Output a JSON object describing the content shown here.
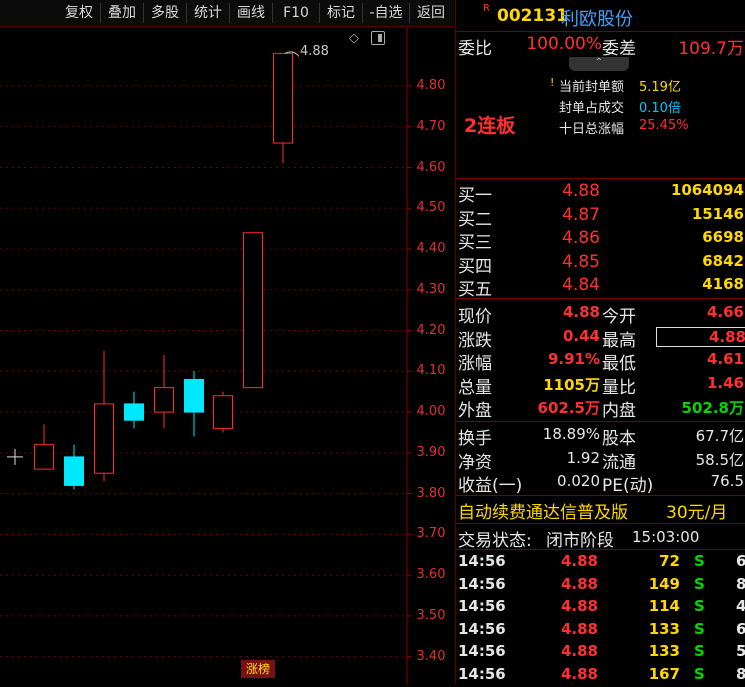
{
  "toolbar": {
    "buttons": [
      "复权",
      "叠加",
      "多股",
      "统计",
      "画线",
      "F10",
      "标记",
      "-自选",
      "返回"
    ]
  },
  "chart": {
    "price_labels": [
      "4.80",
      "4.70",
      "4.60",
      "4.50",
      "4.40",
      "4.30",
      "4.20",
      "4.10",
      "4.00",
      "3.90",
      "3.80",
      "3.70",
      "3.60",
      "3.50",
      "3.40"
    ],
    "last_price_tag": "4.88",
    "badge": "涨榜",
    "colors": {
      "up": "#ff2a2a",
      "down": "#00e8ff",
      "grid": "#6a0000",
      "axis": "#8a0000"
    }
  },
  "chart_data": {
    "type": "candlestick",
    "ylim": [
      3.35,
      4.93
    ],
    "candles": [
      {
        "open": 3.86,
        "close": 3.92,
        "high": 3.97,
        "low": 3.86,
        "dir": "up"
      },
      {
        "open": 3.89,
        "close": 3.82,
        "high": 3.92,
        "low": 3.81,
        "dir": "down"
      },
      {
        "open": 3.85,
        "close": 4.02,
        "high": 4.15,
        "low": 3.83,
        "dir": "up"
      },
      {
        "open": 4.02,
        "close": 3.98,
        "high": 4.05,
        "low": 3.96,
        "dir": "down"
      },
      {
        "open": 4.0,
        "close": 4.06,
        "high": 4.14,
        "low": 3.96,
        "dir": "up"
      },
      {
        "open": 4.08,
        "close": 4.0,
        "high": 4.1,
        "low": 3.94,
        "dir": "down"
      },
      {
        "open": 3.96,
        "close": 4.04,
        "high": 4.05,
        "low": 3.95,
        "dir": "up"
      },
      {
        "open": 4.06,
        "close": 4.44,
        "high": 4.44,
        "low": 4.06,
        "dir": "up"
      },
      {
        "open": 4.66,
        "close": 4.88,
        "high": 4.88,
        "low": 4.61,
        "dir": "up"
      }
    ]
  },
  "panel": {
    "stock_flag": "R",
    "code": "002131",
    "name": "利欧股份",
    "weibi_label": "委比",
    "weibi_value": "100.00%",
    "weicha_label": "委差",
    "weicha_value": "109.7万",
    "board_text": "2连板",
    "seal_rows": [
      {
        "label": "当前封单额",
        "value": "5.19亿",
        "color": "yellow"
      },
      {
        "label": "封单占成交",
        "value": "0.10倍",
        "color": "cyan"
      },
      {
        "label": "十日总涨幅",
        "value": "25.45%",
        "color": "red"
      }
    ],
    "bids": [
      {
        "label": "买一",
        "price": "4.88",
        "vol": "1064094"
      },
      {
        "label": "买二",
        "price": "4.87",
        "vol": "15146"
      },
      {
        "label": "买三",
        "price": "4.86",
        "vol": "6698"
      },
      {
        "label": "买四",
        "price": "4.85",
        "vol": "6842"
      },
      {
        "label": "买五",
        "price": "4.84",
        "vol": "4168"
      }
    ],
    "quote": [
      {
        "l1": "现价",
        "v1": "4.88",
        "c1": "red",
        "l2": "今开",
        "v2": "4.66",
        "c2": "red"
      },
      {
        "l1": "涨跌",
        "v1": "0.44",
        "c1": "red",
        "l2": "最高",
        "v2": "4.88",
        "c2": "red"
      },
      {
        "l1": "涨幅",
        "v1": "9.91%",
        "c1": "red",
        "l2": "最低",
        "v2": "4.61",
        "c2": "red"
      },
      {
        "l1": "总量",
        "v1": "1105万",
        "c1": "yellow",
        "l2": "量比",
        "v2": "1.46",
        "c2": "red"
      },
      {
        "l1": "外盘",
        "v1": "602.5万",
        "c1": "red",
        "l2": "内盘",
        "v2": "502.8万",
        "c2": "green"
      }
    ],
    "stats": [
      {
        "l1": "换手",
        "v1": "18.89%",
        "l2": "股本",
        "v2": "67.7亿"
      },
      {
        "l1": "净资",
        "v1": "1.92",
        "l2": "流通",
        "v2": "58.5亿"
      },
      {
        "l1": "收益(一)",
        "v1": "0.020",
        "l2": "PE(动)",
        "v2": "76.5"
      }
    ],
    "promo_text": "自动续费通达信普及版",
    "promo_price": "30元/月",
    "trade_status_label": "交易状态:",
    "trade_status_value": "闭市阶段",
    "trade_time": "15:03:00",
    "ticks": [
      {
        "time": "14:56",
        "price": "4.88",
        "vol": "72",
        "side": "S",
        "n": "6"
      },
      {
        "time": "14:56",
        "price": "4.88",
        "vol": "149",
        "side": "S",
        "n": "8"
      },
      {
        "time": "14:56",
        "price": "4.88",
        "vol": "114",
        "side": "S",
        "n": "4"
      },
      {
        "time": "14:56",
        "price": "4.88",
        "vol": "133",
        "side": "S",
        "n": "6"
      },
      {
        "time": "14:56",
        "price": "4.88",
        "vol": "133",
        "side": "S",
        "n": "5"
      },
      {
        "time": "14:56",
        "price": "4.88",
        "vol": "167",
        "side": "S",
        "n": "8"
      }
    ]
  }
}
